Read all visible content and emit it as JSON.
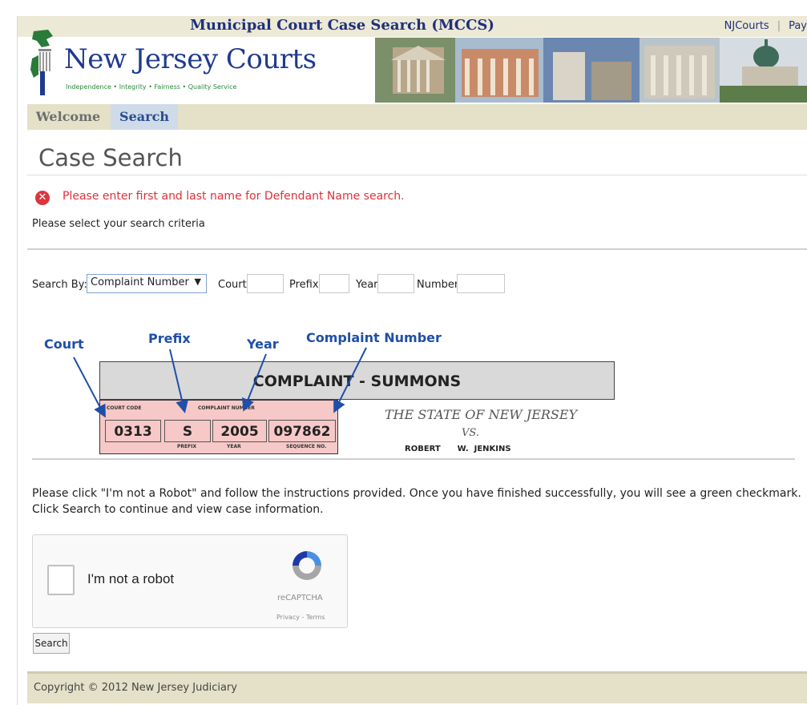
{
  "header": {
    "title": "Municipal Court Case Search (MCCS)",
    "links": [
      "NJCourts",
      "Pay"
    ],
    "logo_name": "New Jersey Courts",
    "logo_tagline": "Independence • Integrity • Fairness • Quality Service"
  },
  "nav": {
    "tabs": [
      {
        "label": "Welcome"
      },
      {
        "label": "Search"
      }
    ]
  },
  "page": {
    "title": "Case Search",
    "error": "Please enter first and last name for Defendant Name search.",
    "criteria_prompt": "Please select your search criteria"
  },
  "search_form": {
    "search_by_label": "Search By:",
    "search_by_value": "Complaint Number",
    "court_label": "Court",
    "prefix_label": "Prefix",
    "year_label": "Year",
    "number_label": "Number"
  },
  "diagram": {
    "annotations": {
      "court": "Court",
      "prefix": "Prefix",
      "year": "Year",
      "complaint_number": "Complaint Number"
    },
    "form_title": "COMPLAINT - SUMMONS",
    "court_code_label": "COURT CODE",
    "complaint_number_label": "COMPLAINT NUMBER",
    "prefix_sub": "PREFIX",
    "year_sub": "YEAR",
    "sequence_sub": "SEQUENCE NO.",
    "court_value": "0313",
    "prefix_value": "S",
    "year_value": "2005",
    "number_value": "097862",
    "state_line": "THE STATE OF NEW JERSEY",
    "vs": "VS.",
    "defendant": "ROBERT      W.  JENKINS"
  },
  "instructions": "Please click \"I'm not a Robot\" and follow the instructions provided. Once you have finished successfully, you will see a green checkmark. Click Search to continue and view case information.",
  "recaptcha": {
    "label": "I'm not a robot",
    "brand": "reCAPTCHA",
    "links": "Privacy - Terms"
  },
  "search_button": "Search",
  "footer": "Copyright © 2012 New Jersey Judiciary",
  "colors": {
    "brand_blue": "#20307a",
    "error_red": "#e0303a",
    "nav_bg": "#e4e1c8",
    "annotation_blue": "#1f4fa8",
    "form_pink": "#f7c8c8"
  }
}
